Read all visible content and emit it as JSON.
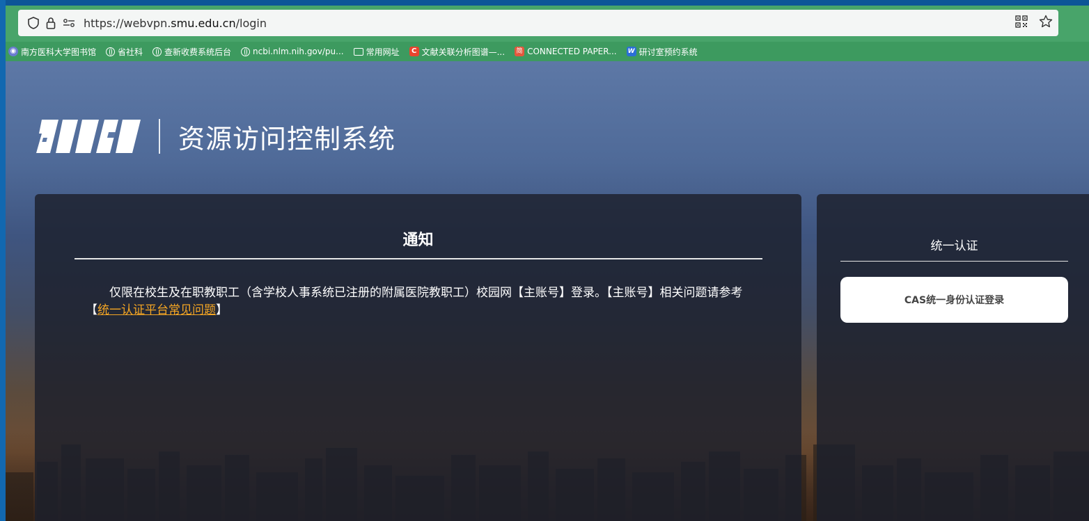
{
  "browser": {
    "url_prefix": "https://webvpn.",
    "url_domain": "smu.edu.cn",
    "url_path": "/login",
    "bookmarks": [
      {
        "label": "南方医科大学图书馆",
        "icon": "library-icon",
        "color": "#6b7bd1"
      },
      {
        "label": "省社科",
        "icon": "globe-icon"
      },
      {
        "label": "查新收费系统后台",
        "icon": "globe-icon"
      },
      {
        "label": "ncbi.nlm.nih.gov/pu...",
        "icon": "globe-icon"
      },
      {
        "label": "常用网址",
        "icon": "folder-icon"
      },
      {
        "label": "文献关联分析图谱—...",
        "icon": "c-logo-icon",
        "color": "#e8442e"
      },
      {
        "label": "CONNECTED PAPER...",
        "icon": "jian-logo-icon",
        "color": "#e4573d"
      },
      {
        "label": "研讨室预约系统",
        "icon": "booking-logo-icon",
        "color": "#2b6fd6"
      }
    ]
  },
  "header": {
    "title": "资源访问控制系统"
  },
  "notice": {
    "title": "通知",
    "body_text": "仅限在校生及在职教职工（含学校人事系统已注册的附属医院教职工）校园网【主账号】登录。【主账号】相关问题请参考【",
    "link_text": "统一认证平台常见问题",
    "body_end": "】"
  },
  "auth": {
    "title": "统一认证",
    "cas_button": "CAS统一身份认证登录"
  },
  "colors": {
    "link": "#f5a623",
    "bookmark_bar": "#3d9a5f"
  }
}
